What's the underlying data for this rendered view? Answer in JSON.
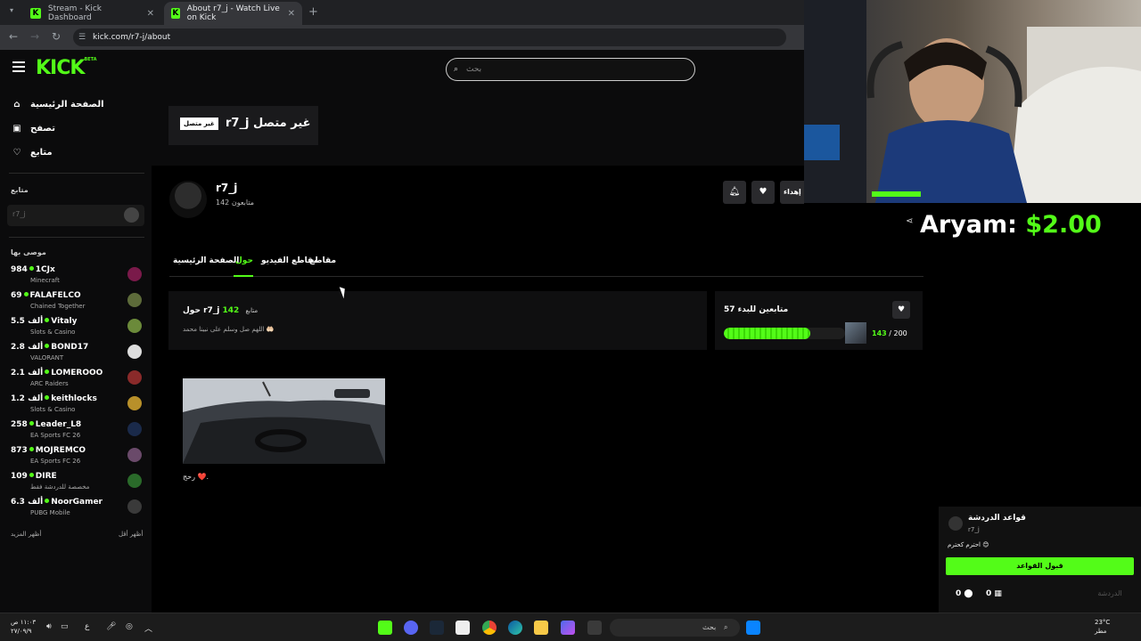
{
  "browser": {
    "tabs": [
      {
        "label": "Stream - Kick Dashboard",
        "favicon": "K"
      },
      {
        "label": "About r7_j - Watch Live on Kick",
        "favicon": "K"
      }
    ],
    "url": "kick.com/r7-j/about"
  },
  "header": {
    "logo": "KICK",
    "logo_tag": "BETA",
    "search_placeholder": "بحث"
  },
  "sidebar": {
    "nav": [
      {
        "label": "الصفحة الرئيسية",
        "icon": "home-icon"
      },
      {
        "label": "تصفح",
        "icon": "browse-icon"
      },
      {
        "label": "متابع",
        "icon": "heart-icon"
      }
    ],
    "following_heading": "متابع",
    "following": [
      {
        "name": "r7_j"
      }
    ],
    "recommended_heading": "موصى بها",
    "recommended": [
      {
        "viewers": "984",
        "name": "1CJx",
        "category": "Minecraft",
        "avatar_color": "#7a1a4a"
      },
      {
        "viewers": "69",
        "name": "FALAFELCO",
        "category": "Chained Together",
        "avatar_color": "#5d6b3a"
      },
      {
        "viewers": "5.5 ألف",
        "name": "Vitaly",
        "category": "Slots & Casino",
        "avatar_color": "#6b8a3a"
      },
      {
        "viewers": "2.8 ألف",
        "name": "BOND17",
        "category": "VALORANT",
        "avatar_color": "#dddddd"
      },
      {
        "viewers": "2.1 ألف",
        "name": "LOMEROOO",
        "category": "ARC Raiders",
        "avatar_color": "#8a2a2a"
      },
      {
        "viewers": "1.2 ألف",
        "name": "keithlocks",
        "category": "Slots & Casino",
        "avatar_color": "#b8902a"
      },
      {
        "viewers": "258",
        "name": "Leader_L8",
        "category": "EA Sports FC 26",
        "avatar_color": "#1a2a4a"
      },
      {
        "viewers": "873",
        "name": "MOJREMCO",
        "category": "EA Sports FC 26",
        "avatar_color": "#6a4a6a"
      },
      {
        "viewers": "109",
        "name": "DIRE",
        "category": "مخصصة للدردشة فقط",
        "avatar_color": "#2a6a2a"
      },
      {
        "viewers": "6.3 ألف",
        "name": "NoorGamer",
        "category": "PUBG Mobile",
        "avatar_color": "#3a3a3a"
      }
    ],
    "show_more": "أظهر المزيد",
    "show_less": "أظهر أقل"
  },
  "channel": {
    "offline_badge": "غير متصل",
    "offline_title": "r7_j غير متصل",
    "name": "r7_j",
    "followers": "142 متابعون",
    "gift_label": "إهداء",
    "tabs": [
      "الصفحة الرئيسية",
      "حول",
      "مقاطع الفيديو",
      "مقاطع"
    ],
    "active_tab": 1,
    "about": {
      "title": "حول r7_j",
      "follower_count": "142",
      "follower_word": "متابع",
      "bio": "اللهم صل وسلم على نبينا محمد 🤲🏻"
    },
    "goal": {
      "title": "متابعين للبدء 57",
      "current": "143",
      "target": "/ 200",
      "progress": 0.715
    },
    "bio_caption": "رحج ❤️."
  },
  "overlay": {
    "donor": "Aryam:",
    "amount": "$2.00"
  },
  "chat": {
    "rules_title": "قواعد الدردشة",
    "rules_channel": "r7_j",
    "rules_text": "احترم كحترم 😊",
    "accept_label": "قبول القواعد",
    "count_a": "0",
    "count_b": "0",
    "send_label": "الدردشة"
  },
  "taskbar": {
    "clock_time": "١١:٠٣ ص",
    "clock_date": "٢٧/٠٩/٩",
    "lang": "ع",
    "search_label": "بحث",
    "temp": "23°C",
    "weather": "مطر"
  }
}
